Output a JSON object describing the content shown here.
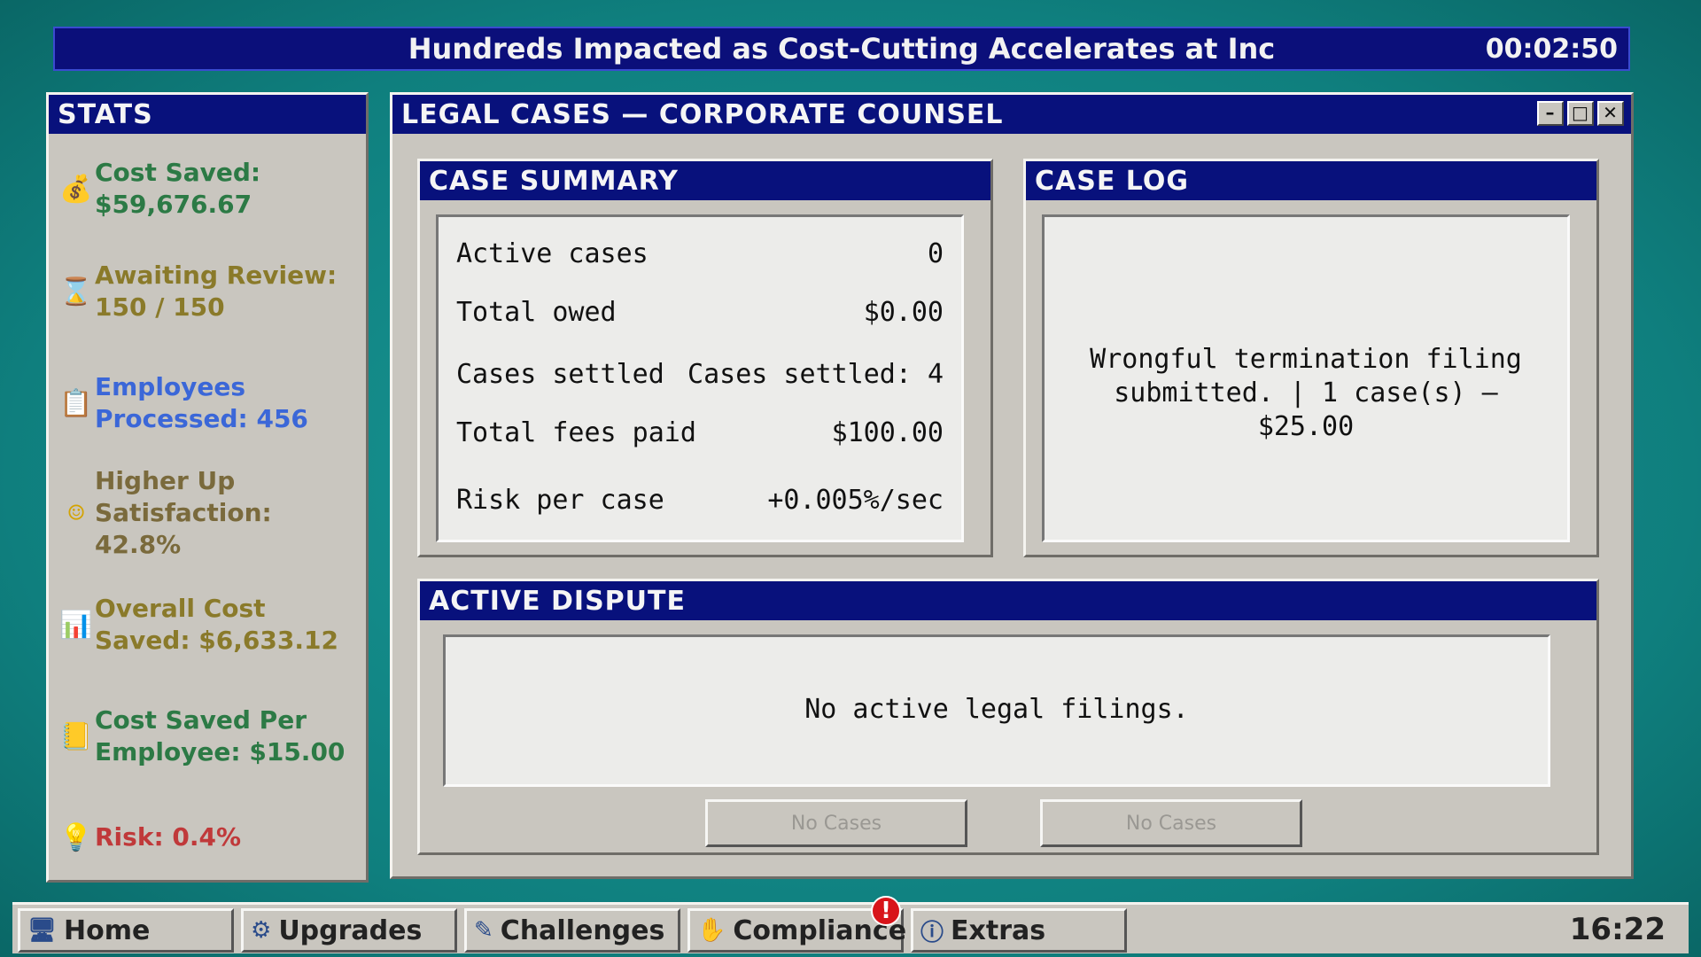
{
  "ticker": {
    "headline": "Hundreds Impacted as Cost-Cutting Accelerates at Inc",
    "timer": "00:02:50"
  },
  "stats": {
    "title": "STATS",
    "items": [
      {
        "icon": "money-bag-icon",
        "glyph": "💰",
        "label": "Cost Saved:",
        "value": "$59,676.67",
        "color": "#2c7a45"
      },
      {
        "icon": "hourglass-icon",
        "glyph": "⌛",
        "label": "Awaiting Review:",
        "value": "150 / 150",
        "color": "#8a7a2a"
      },
      {
        "icon": "clipboard-icon",
        "glyph": "📋",
        "label": "Employees",
        "value": "Processed: 456",
        "color": "#3b67d8"
      },
      {
        "icon": "smiley-icon",
        "glyph": "☺",
        "label": "Higher Up Satisfaction:",
        "value": "42.8%",
        "color": "#7a6a3c"
      },
      {
        "icon": "bar-chart-icon",
        "glyph": "📊",
        "label": "Overall Cost",
        "value": "Saved: $6,633.12",
        "color": "#8a7a2a"
      },
      {
        "icon": "ledger-icon",
        "glyph": "📒",
        "label": "Cost Saved Per",
        "value": "Employee: $15.00",
        "color": "#2c7a45"
      },
      {
        "icon": "lightbulb-icon",
        "glyph": "💡",
        "label": "Risk: 0.4%",
        "value": "",
        "color": "#c0393a"
      }
    ]
  },
  "window": {
    "title": "LEGAL CASES — CORPORATE COUNSEL",
    "min": "–",
    "max": "□",
    "close": "✕"
  },
  "summary": {
    "title": "CASE SUMMARY",
    "rows": [
      {
        "label": "Active cases",
        "value": "0"
      },
      {
        "label": "Total owed",
        "value": "$0.00"
      },
      {
        "label": "Cases settled",
        "value": "Cases settled: 4"
      },
      {
        "label": "Total fees paid",
        "value": "$100.00"
      },
      {
        "label": "Risk per case",
        "value": "+0.005%/sec"
      }
    ]
  },
  "log": {
    "title": "CASE LOG",
    "line1": "Wrongful termination filing",
    "line2": "submitted. | 1 case(s) — $25.00"
  },
  "dispute": {
    "title": "ACTIVE DISPUTE",
    "message": "No active legal filings.",
    "button_left": "No Cases",
    "button_right": "No Cases"
  },
  "taskbar": {
    "items": [
      {
        "label": "Home",
        "icon": "monitor-icon",
        "glyph": "🖥"
      },
      {
        "label": "Upgrades",
        "icon": "upgrade-icon",
        "glyph": "⚙"
      },
      {
        "label": "Challenges",
        "icon": "puzzle-icon",
        "glyph": "✎"
      },
      {
        "label": "Compliance",
        "icon": "compliance-icon",
        "glyph": "✋"
      },
      {
        "label": "Extras",
        "icon": "info-icon",
        "glyph": "ⓘ"
      }
    ],
    "alert": "!",
    "clock": "16:22"
  }
}
